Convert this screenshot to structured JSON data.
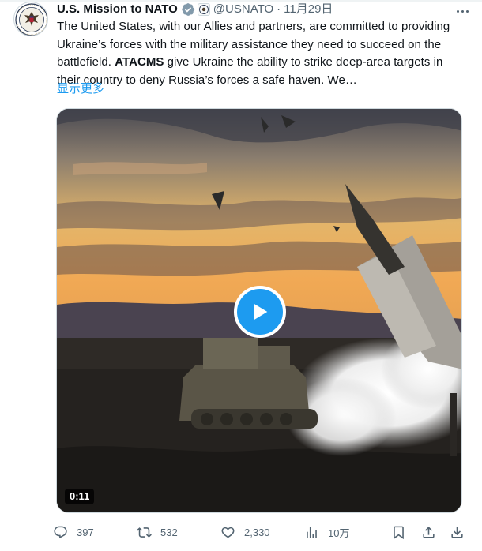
{
  "tweet": {
    "author_name": "U.S. Mission to NATO",
    "handle": "@USNATO",
    "separator": "·",
    "date": "11月29日",
    "text_part1": "The United States, with our Allies and partners, are committed to providing Ukraine’s forces with the military assistance they need to succeed on the battlefield. ",
    "text_bold": "ATACMS",
    "text_part2": " give Ukraine the ability to strike deep-area targets in their country to deny Russia’s forces a safe haven. We…",
    "show_more": "显示更多"
  },
  "media": {
    "duration": "0:11",
    "accent_color": "#1d9bf0"
  },
  "actions": {
    "replies": "397",
    "reposts": "532",
    "likes": "2,330",
    "views": "10万"
  },
  "icons": [
    "seal-icon",
    "verified-badge-icon",
    "government-badge-icon",
    "more-icon",
    "play-icon",
    "reply-icon",
    "repost-icon",
    "like-icon",
    "views-icon",
    "bookmark-icon",
    "share-icon"
  ]
}
